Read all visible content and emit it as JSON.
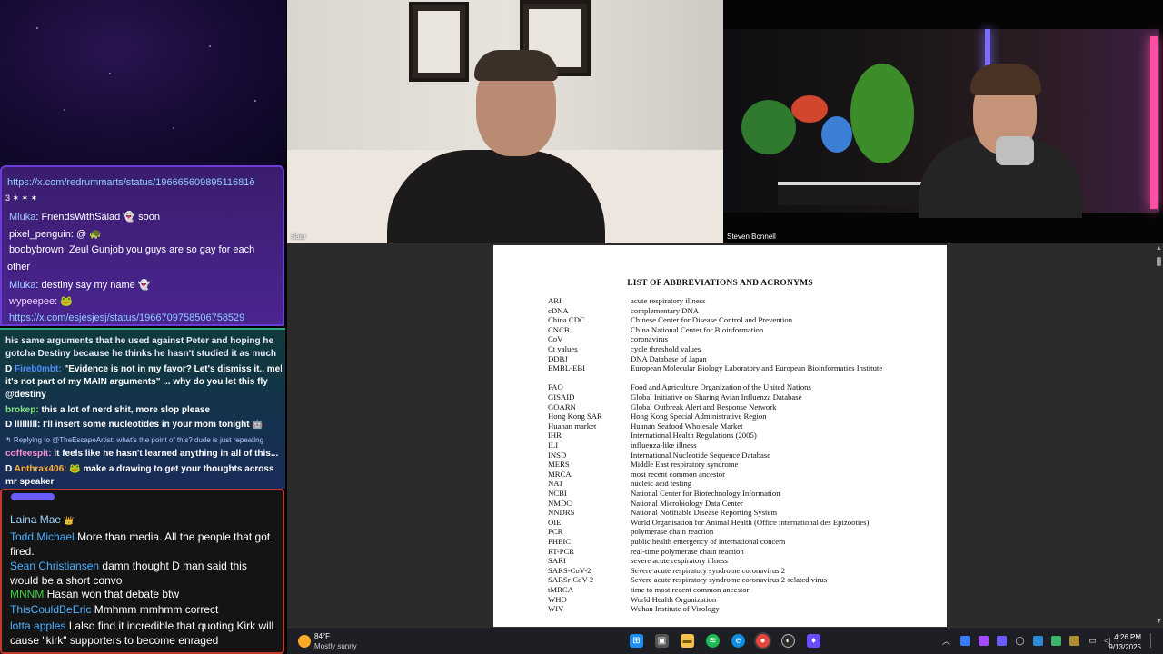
{
  "chat_top": {
    "messages": [
      {
        "text": "https://x.com/redrummarts/status/19666560989511681ĕ",
        "kind": "link"
      },
      {
        "text": "3 ✶ ✶ ✶",
        "kind": "plain"
      },
      {
        "user": "Mluka",
        "text": ": FriendsWithSalad 👻 soon"
      },
      {
        "user": "pixel_penguin",
        "text": ": @ 🐢"
      },
      {
        "user": "boobybrown",
        "text": ": Zeul Gunjob you guys are so gay for each"
      },
      {
        "text": "other",
        "kind": "plain"
      },
      {
        "user": "Mluka",
        "text": ": destiny say my name 👻"
      },
      {
        "user": "wypeepee",
        "text": ": 🐸"
      },
      {
        "text": "https://x.com/esjesjesj/status/1966709758506758529",
        "kind": "link"
      }
    ]
  },
  "chat_mid": {
    "messages": [
      {
        "text": "his same arguments that he used against Peter and hoping he"
      },
      {
        "text": "gotcha Destiny because he thinks he hasn't studied it as much"
      },
      {
        "badge": "D",
        "user": "Fireb0mbt:",
        "text": "\"Evidence is not in my favor? Let's dismiss it.. meh"
      },
      {
        "text": "it's not part of my MAIN arguments\" ... why do you let this fly"
      },
      {
        "text": "@destiny"
      },
      {
        "user": "brokep:",
        "text": "this a lot of nerd shit, more slop please"
      },
      {
        "badge": "D",
        "user": "lllllllll:",
        "text": "I'll insert some nucleotides in your mom tonight 🤖"
      },
      {
        "text": "↰ Replying to @TheEscapeArtist: what's the point of this? dude is just repeating"
      },
      {
        "user": "coffeespit:",
        "text": "it feels like he hasn't learned anything in all of this..."
      },
      {
        "badge": "D",
        "user": "Anthrax406:",
        "text": "🐸 make a drawing to get your thoughts across"
      },
      {
        "text": "mr speaker"
      }
    ]
  },
  "chat_bottom": {
    "messages": [
      {
        "user": "Laina Mae",
        "text": "👑"
      },
      {
        "user": "Todd Michael",
        "text": "More than media. All the people that got fired."
      },
      {
        "user": "Sean Christiansen",
        "text": "damn thought D man said this would be a short convo"
      },
      {
        "user": "MNNM",
        "text": "Hasan won that debate btw"
      },
      {
        "user": "ThisCouldBeEric",
        "text": "Mmhmm mmhmm correct"
      },
      {
        "user": "lotta apples",
        "text": "I also find it incredible that quoting Kirk will cause \"kirk\" supporters to become enraged"
      }
    ]
  },
  "video": {
    "left_label": "Saar",
    "right_label": "Steven Bonnell"
  },
  "document": {
    "title": "LIST OF ABBREVIATIONS AND ACRONYMS",
    "entries": [
      {
        "abbr": "ARI",
        "def": "acute respiratory illness"
      },
      {
        "abbr": "cDNA",
        "def": "complementary DNA"
      },
      {
        "abbr": "China CDC",
        "def": "Chinese Center for Disease Control and Prevention"
      },
      {
        "abbr": "CNCB",
        "def": "China National Center for Bioinformation"
      },
      {
        "abbr": "CoV",
        "def": "coronavirus"
      },
      {
        "abbr": "Ct values",
        "def": "cycle threshold values"
      },
      {
        "abbr": "DDBJ",
        "def": "DNA Database of Japan"
      },
      {
        "abbr": "EMBL-EBI",
        "def": "European Molecular Biology Laboratory and European Bioinformatics Institute"
      },
      {
        "abbr": "FAO",
        "def": "Food and Agriculture Organization of the United Nations"
      },
      {
        "abbr": "GISAID",
        "def": "Global Initiative on Sharing Avian Influenza Database"
      },
      {
        "abbr": "GOARN",
        "def": "Global Outbreak Alert and Response Network"
      },
      {
        "abbr": "Hong Kong SAR",
        "def": "Hong Kong Special Administrative Region"
      },
      {
        "abbr": "Huanan market",
        "def": "Huanan Seafood Wholesale Market"
      },
      {
        "abbr": "IHR",
        "def": "International Health Regulations (2005)"
      },
      {
        "abbr": "ILI",
        "def": "influenza-like illness"
      },
      {
        "abbr": "INSD",
        "def": "International Nucleotide Sequence Database"
      },
      {
        "abbr": "MERS",
        "def": "Middle East respiratory syndrome"
      },
      {
        "abbr": "MRCA",
        "def": "most recent common ancestor"
      },
      {
        "abbr": "NAT",
        "def": "nucleic acid testing"
      },
      {
        "abbr": "NCBI",
        "def": "National Center for Biotechnology Information"
      },
      {
        "abbr": "NMDC",
        "def": "National Microbiology Data Center"
      },
      {
        "abbr": "NNDRS",
        "def": "National Notifiable Disease Reporting System"
      },
      {
        "abbr": "OIE",
        "def": "World Organisation for Animal Health (Office international des Epizooties)"
      },
      {
        "abbr": "PCR",
        "def": "polymerase chain reaction"
      },
      {
        "abbr": "PHEIC",
        "def": "public health emergency of international concern"
      },
      {
        "abbr": "RT-PCR",
        "def": "real-time polymerase chain reaction"
      },
      {
        "abbr": "SARI",
        "def": "severe acute respiratory illness"
      },
      {
        "abbr": "SARS-CoV-2",
        "def": "Severe acute respiratory syndrome coronavirus 2"
      },
      {
        "abbr": "SARSr-CoV-2",
        "def": "Severe acute respiratory syndrome coronavirus 2-related virus"
      },
      {
        "abbr": "tMRCA",
        "def": "time to most recent common ancestor"
      },
      {
        "abbr": "WHO",
        "def": "World Health Organization"
      },
      {
        "abbr": "WIV",
        "def": "Wuhan Institute of Virology"
      }
    ]
  },
  "taskbar": {
    "weather_temp": "84°F",
    "weather_condition": "Mostly sunny",
    "time": "4:26 PM",
    "date": "9/13/2025",
    "pinned": [
      "windows-start",
      "task-view",
      "file-explorer",
      "spotify",
      "edge",
      "chrome",
      "obs",
      "app"
    ]
  }
}
